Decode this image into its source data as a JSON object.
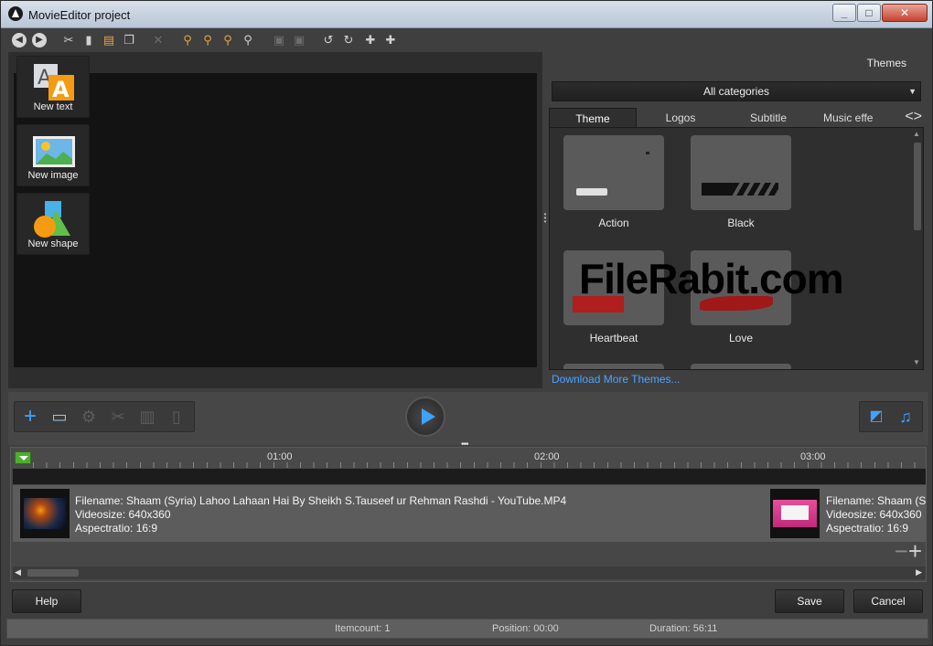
{
  "window": {
    "title": "MovieEditor project"
  },
  "toolbar": {
    "icons": [
      "back-icon",
      "forward-icon",
      "cut-icon",
      "delete-icon",
      "paste-icon",
      "copy-icon",
      "remove-icon",
      "zoom-in-icon",
      "zoom-in-alt-icon",
      "zoom-out-icon",
      "zoom-fit-icon",
      "fit-screen-icon",
      "fit-width-icon",
      "rotate-left-icon",
      "rotate-right-icon",
      "split-icon",
      "join-icon"
    ]
  },
  "tools": {
    "new_text": "New text",
    "new_image": "New image",
    "new_shape": "New shape"
  },
  "themes": {
    "heading": "Themes",
    "category": "All categories",
    "tabs": [
      "Theme",
      "Logos",
      "Subtitle",
      "Music effe"
    ],
    "items": [
      {
        "name": "Action"
      },
      {
        "name": "Black"
      },
      {
        "name": "Heartbeat"
      },
      {
        "name": "Love"
      }
    ],
    "download_link": "Download More Themes..."
  },
  "watermark": "FileRabit.com",
  "timeline": {
    "ticks": [
      "01:00",
      "02:00",
      "03:00"
    ],
    "clips": [
      {
        "filename": "Filename: Shaam (Syria) Lahoo Lahaan Hai By Sheikh S.Tauseef ur Rehman Rashdi - YouTube.MP4",
        "videosize": "Videosize: 640x360",
        "aspect": "Aspectratio: 16:9"
      },
      {
        "filename": "Filename: Shaam (Syi",
        "videosize": "Videosize: 640x360",
        "aspect": "Aspectratio: 16:9"
      }
    ]
  },
  "buttons": {
    "help": "Help",
    "save": "Save",
    "cancel": "Cancel"
  },
  "status": {
    "itemcount": "Itemcount: 1",
    "position": "Position: 00:00",
    "duration": "Duration: 56:11"
  },
  "colors": {
    "accent": "#3fa2ff",
    "link": "#4aa3ff",
    "marker": "#4caf2e"
  }
}
